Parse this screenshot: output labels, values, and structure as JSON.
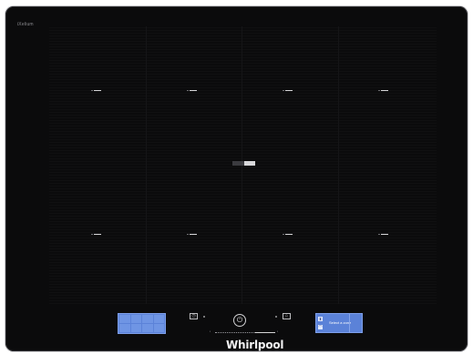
{
  "appliance": {
    "series_label": "iXelium",
    "brand": "Whirlpool"
  },
  "cooking_zones": [
    {
      "id": "zone-1",
      "row": "top"
    },
    {
      "id": "zone-2",
      "row": "top"
    },
    {
      "id": "zone-3",
      "row": "top"
    },
    {
      "id": "zone-4",
      "row": "top"
    },
    {
      "id": "zone-5",
      "row": "bottom"
    },
    {
      "id": "zone-6",
      "row": "bottom"
    },
    {
      "id": "zone-7",
      "row": "bottom"
    },
    {
      "id": "zone-8",
      "row": "bottom"
    }
  ],
  "controls": {
    "power_icon": "power-icon",
    "timer_icon": "timer-icon",
    "lock_icon": "lock-icon",
    "slider_level": 0.33
  },
  "display_right": {
    "label": "Select a zone"
  },
  "colors": {
    "panel": "#0b0b0c",
    "display_blue": "#5b82d8",
    "accent_light": "#d8d8da"
  }
}
